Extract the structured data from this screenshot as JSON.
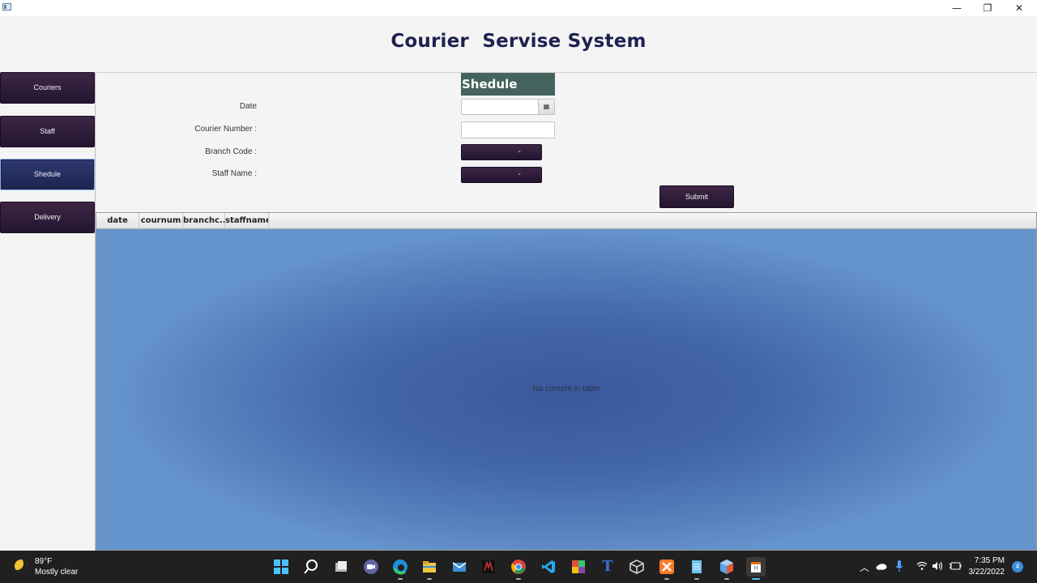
{
  "window": {
    "minimize_glyph": "—",
    "maximize_glyph": "❐",
    "close_glyph": "✕"
  },
  "app_title": "Courier  Servise System",
  "sidebar": {
    "items": [
      {
        "label": "Couriers"
      },
      {
        "label": "Staff"
      },
      {
        "label": "Shedule"
      },
      {
        "label": "Delivery"
      }
    ]
  },
  "form": {
    "header": "Shedule",
    "date_label": "Date",
    "date_value": "",
    "courier_number_label": "Courier Number :",
    "courier_number_value": "",
    "branch_code_label": "Branch Code :",
    "branch_code_value": "",
    "staff_name_label": "Staff Name :",
    "staff_name_value": "",
    "submit_label": "Submit"
  },
  "table": {
    "columns": [
      "date",
      "cournum",
      "branchc...",
      "staffname"
    ],
    "empty_message": "No content in table"
  },
  "taskbar": {
    "weather_temp": "89°F",
    "weather_desc": "Mostly clear",
    "time": "7:35 PM",
    "date": "3/22/2022",
    "notification_count": "4",
    "apps": [
      {
        "icon": "windows-start-icon"
      },
      {
        "icon": "search-icon"
      },
      {
        "icon": "task-view-icon"
      },
      {
        "icon": "teams-chat-icon"
      },
      {
        "icon": "edge-browser-icon"
      },
      {
        "icon": "file-explorer-icon"
      },
      {
        "icon": "mail-icon"
      },
      {
        "icon": "game-app-icon"
      },
      {
        "icon": "chrome-icon"
      },
      {
        "icon": "vscode-icon"
      },
      {
        "icon": "office-app-icon"
      },
      {
        "icon": "typora-icon"
      },
      {
        "icon": "virtualbox-icon"
      },
      {
        "icon": "xampp-icon"
      },
      {
        "icon": "notepad-icon"
      },
      {
        "icon": "netbeans-icon"
      },
      {
        "icon": "java-app-icon"
      }
    ]
  },
  "colors": {
    "title": "#1e2150",
    "nav_button": "#2e1c38",
    "nav_active": "#243066",
    "form_header": "#44635d",
    "table_body": "#4366a9",
    "taskbar": "#202020"
  }
}
